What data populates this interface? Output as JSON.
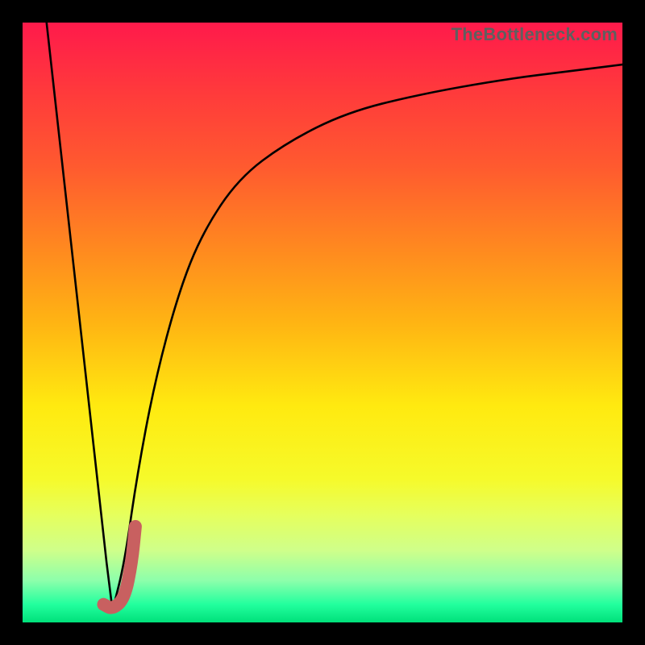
{
  "watermark": "TheBottleneck.com",
  "colors": {
    "frame": "#000000",
    "gradient_top": "#ff1a4b",
    "gradient_bottom": "#00e07a",
    "curve": "#000000",
    "accent": "#c86060",
    "watermark_text": "#5f5f5f"
  },
  "chart_data": {
    "type": "line",
    "title": "",
    "xlabel": "",
    "ylabel": "",
    "xlim": [
      0,
      100
    ],
    "ylim": [
      0,
      100
    ],
    "grid": false,
    "legend": false,
    "series": [
      {
        "name": "left-descent",
        "x": [
          4,
          6,
          8,
          10,
          12,
          14,
          15
        ],
        "values": [
          100,
          82,
          64,
          46,
          28,
          10,
          2
        ]
      },
      {
        "name": "main-curve",
        "x": [
          15,
          17,
          19,
          22,
          26,
          30,
          36,
          44,
          54,
          66,
          80,
          92,
          100
        ],
        "values": [
          2,
          10,
          24,
          40,
          55,
          65,
          74,
          80,
          85,
          88,
          90.5,
          92,
          93
        ]
      },
      {
        "name": "accent-hook",
        "x": [
          13.5,
          15,
          17,
          18.2,
          18.8
        ],
        "values": [
          3,
          2.2,
          4,
          10,
          16
        ]
      }
    ],
    "annotations": [
      {
        "text": "TheBottleneck.com",
        "position": "top-right"
      }
    ]
  }
}
